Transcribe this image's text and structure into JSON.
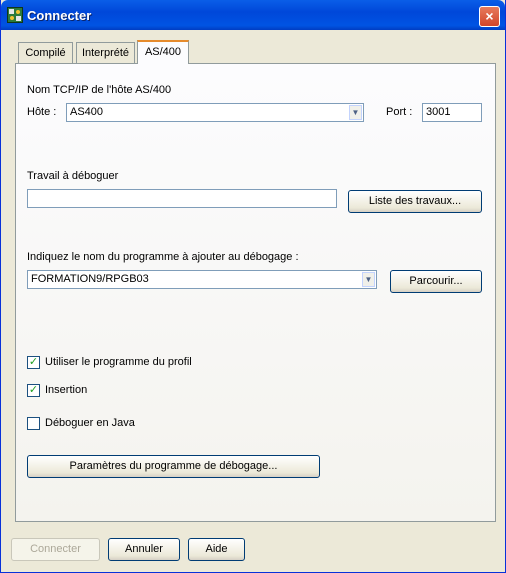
{
  "window": {
    "title": "Connecter",
    "icon": "debugger-app-icon",
    "close_glyph": "×"
  },
  "tabs": [
    {
      "label": "Compilé"
    },
    {
      "label": "Interprété"
    },
    {
      "label": "AS/400"
    }
  ],
  "host": {
    "group_label": "Nom TCP/IP de l'hôte AS/400",
    "host_label": "Hôte :",
    "host_value": "AS400",
    "port_label": "Port :",
    "port_value": "3001"
  },
  "job": {
    "label": "Travail à déboguer",
    "value": "",
    "list_button": "Liste des travaux..."
  },
  "program": {
    "label": "Indiquez le nom du programme à ajouter au débogage :",
    "value": "FORMATION9/RPGB03",
    "browse_button": "Parcourir..."
  },
  "options": [
    {
      "label": "Utiliser le programme du profil",
      "checked": true
    },
    {
      "label": "Insertion",
      "checked": true
    },
    {
      "label": "Déboguer en Java",
      "checked": false
    }
  ],
  "check_glyph": "✓",
  "arrow_glyph": "▼",
  "params_button": "Paramètres du programme de débogage...",
  "footer": {
    "connect": "Connecter",
    "cancel": "Annuler",
    "help": "Aide"
  }
}
